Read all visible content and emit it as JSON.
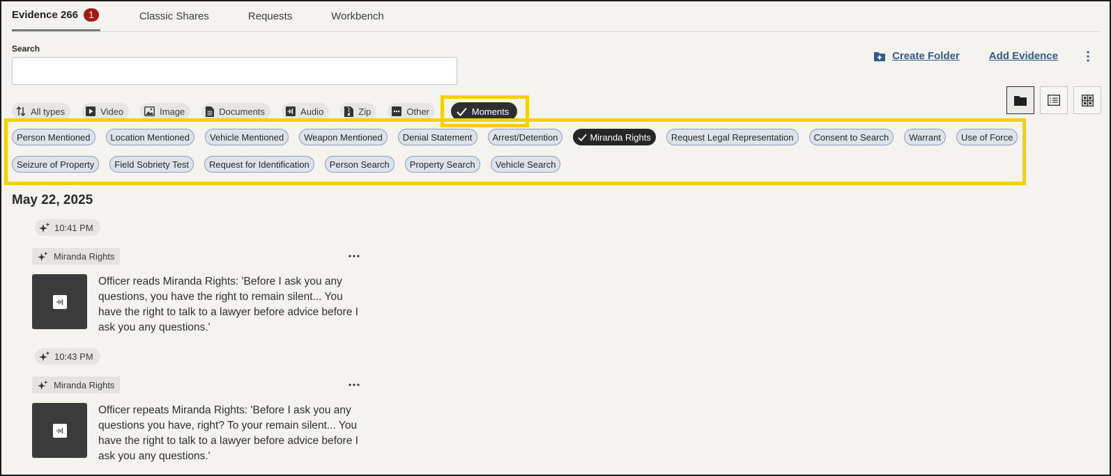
{
  "tabs": [
    {
      "label": "Evidence 266",
      "badge": "1",
      "active": true
    },
    {
      "label": "Classic Shares"
    },
    {
      "label": "Requests"
    },
    {
      "label": "Workbench"
    }
  ],
  "search": {
    "label": "Search",
    "value": "",
    "placeholder": ""
  },
  "actions": {
    "create_folder": "Create Folder",
    "add_evidence": "Add Evidence"
  },
  "type_filters": [
    {
      "label": "All types",
      "icon": "sort-icon"
    },
    {
      "label": "Video",
      "icon": "video-icon"
    },
    {
      "label": "Image",
      "icon": "image-icon"
    },
    {
      "label": "Documents",
      "icon": "document-icon"
    },
    {
      "label": "Audio",
      "icon": "audio-icon"
    },
    {
      "label": "Zip",
      "icon": "zip-icon"
    },
    {
      "label": "Other",
      "icon": "other-icon"
    },
    {
      "label": "Moments",
      "icon": "checkmark-icon",
      "selected": true
    }
  ],
  "view_modes": [
    {
      "name": "folder-view",
      "active": true
    },
    {
      "name": "list-view"
    },
    {
      "name": "grid-view"
    }
  ],
  "moment_tags": [
    [
      "Person Mentioned",
      "Location Mentioned",
      "Vehicle Mentioned",
      "Weapon Mentioned",
      "Denial Statement",
      "Arrest/Detention",
      "Miranda Rights",
      "Request Legal Representation",
      "Consent to Search",
      "Warrant",
      "Use of Force"
    ],
    [
      "Seizure of Property",
      "Field Sobriety Test",
      "Request for Identification",
      "Person Search",
      "Property Search",
      "Vehicle Search"
    ]
  ],
  "selected_tag": "Miranda Rights",
  "date_heading": "May 22, 2025",
  "moments": [
    {
      "time": "10:41 PM",
      "label": "Miranda Rights",
      "text": "Officer reads Miranda Rights: 'Before I ask you any questions, you have the right to remain silent... You have the right to talk to a lawyer before advice before I ask you any questions.'"
    },
    {
      "time": "10:43 PM",
      "label": "Miranda Rights",
      "text": "Officer repeats Miranda Rights: 'Before I ask you any questions you have, right? To your remain silent... You have the right to talk to a lawyer before advice before I ask you any questions.'"
    }
  ],
  "colors": {
    "accent_link": "#2e5a8e",
    "badge": "#a31a12",
    "highlight": "#f5d000",
    "selected_chip": "#2f2f2f",
    "tag_bg": "#dde3ea"
  }
}
